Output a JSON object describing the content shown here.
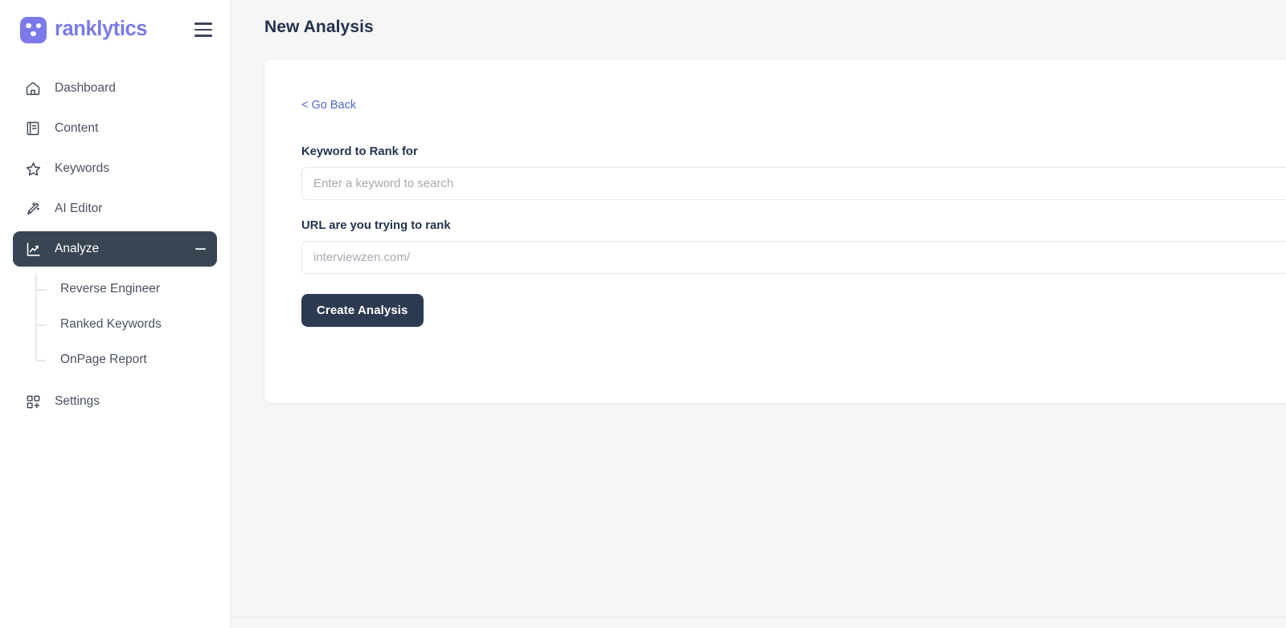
{
  "brand": {
    "name": "ranklytics",
    "logo_color": "#7b7ae8",
    "menu_icon": "hamburger-icon"
  },
  "sidebar": {
    "items": [
      {
        "label": "Dashboard",
        "icon": "home-icon",
        "active": false
      },
      {
        "label": "Content",
        "icon": "book-icon",
        "active": false
      },
      {
        "label": "Keywords",
        "icon": "star-icon",
        "active": false
      },
      {
        "label": "AI Editor",
        "icon": "magic-wand-icon",
        "active": false
      },
      {
        "label": "Analyze",
        "icon": "chart-line-icon",
        "active": true,
        "collapse_glyph": "minus-icon"
      }
    ],
    "submenu": [
      {
        "label": "Reverse Engineer"
      },
      {
        "label": "Ranked Keywords"
      },
      {
        "label": "OnPage Report"
      }
    ],
    "tail": [
      {
        "label": "Settings",
        "icon": "grid-plus-icon",
        "active": false
      }
    ],
    "active_bg": "#3a4554"
  },
  "header": {
    "title": "New Analysis"
  },
  "form": {
    "go_back_label": "< Go Back",
    "go_back_color": "#4f69c4",
    "keyword_label": "Keyword to Rank for",
    "keyword_value": "",
    "keyword_placeholder": "Enter a keyword to search",
    "url_label": "URL are you trying to rank",
    "url_value": "",
    "url_placeholder": "interviewzen.com/",
    "submit_label": "Create Analysis",
    "submit_color": "#2d3b52"
  },
  "theme": {
    "page_bg": "#f6f6f7",
    "card_bg": "#ffffff",
    "title_color": "#23314d"
  }
}
